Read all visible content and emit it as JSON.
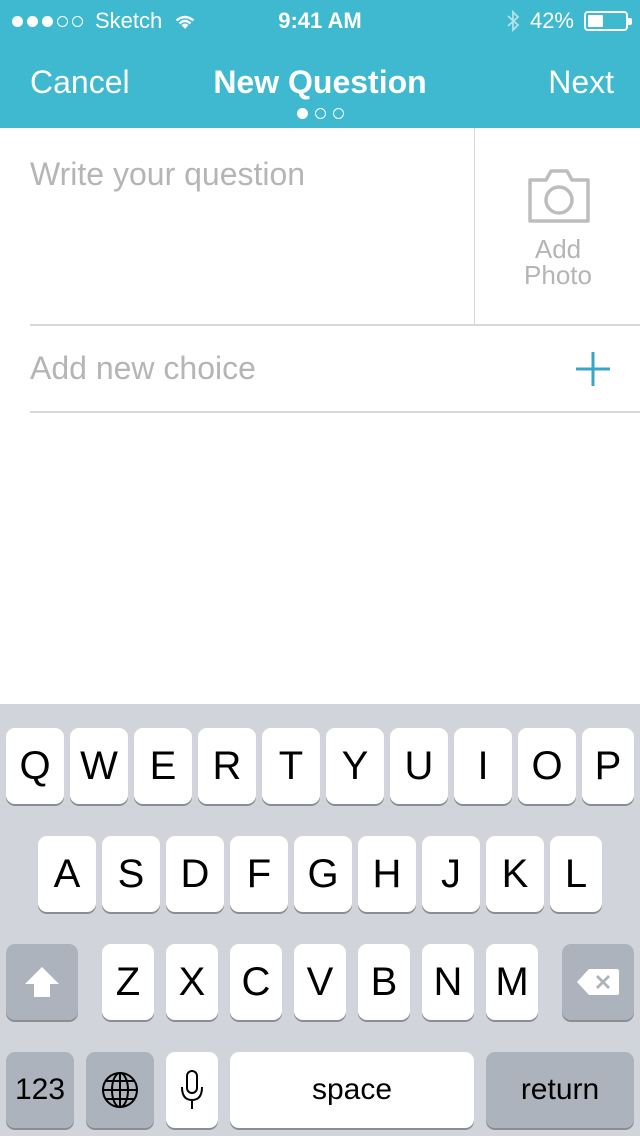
{
  "status_bar": {
    "carrier": "Sketch",
    "time": "9:41 AM",
    "battery": "42%",
    "battery_level": 0.42,
    "signal_bars_filled": 3,
    "signal_bars_total": 5
  },
  "nav": {
    "cancel_label": "Cancel",
    "title": "New Question",
    "next_label": "Next",
    "page_count": 3,
    "current_page": 1
  },
  "question": {
    "placeholder": "Write your question"
  },
  "photo": {
    "label_line1": "Add",
    "label_line2": "Photo",
    "icon": "camera-icon"
  },
  "choice": {
    "placeholder": "Add new choice",
    "icon": "plus-icon"
  },
  "keyboard": {
    "row1": [
      "Q",
      "W",
      "E",
      "R",
      "T",
      "Y",
      "U",
      "I",
      "O",
      "P"
    ],
    "row2": [
      "A",
      "S",
      "D",
      "F",
      "G",
      "H",
      "J",
      "K",
      "L"
    ],
    "row3": [
      "Z",
      "X",
      "C",
      "V",
      "B",
      "N",
      "M"
    ],
    "numbers_label": "123",
    "space_label": "space",
    "return_label": "return"
  },
  "colors": {
    "accent": "#3fb9cf",
    "plus_icon": "#3aa6c6",
    "placeholder_text": "#b5b5b5",
    "keyboard_bg": "#d1d5db"
  }
}
